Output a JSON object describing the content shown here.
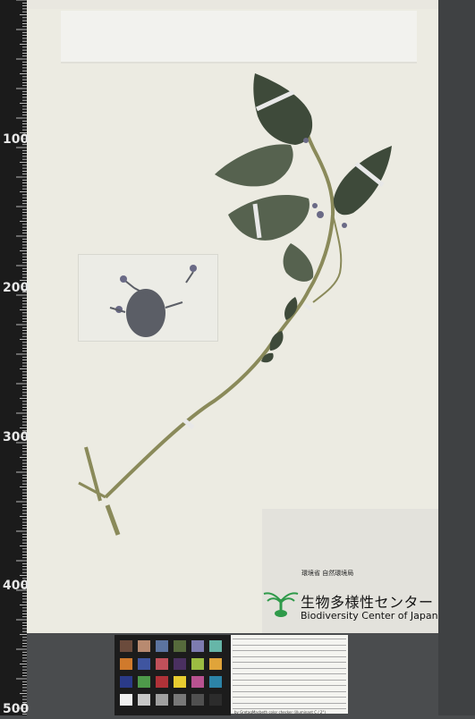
{
  "ruler": {
    "labels": [
      "100",
      "200",
      "300",
      "400",
      "500"
    ]
  },
  "org": {
    "jp_small": "環境省 自然環境局",
    "jp_title": "生物多様性センター",
    "en_title": "Biodiversity Center of Japan"
  },
  "color_table_caption": "by GretagMacbeth color checker (illuminant C / 2°)",
  "colors": {
    "leaf": "#3e4a3a",
    "leaf_light": "#56624f",
    "stem": "#8a8a5a",
    "flower": "#6a6a86",
    "tape": "#e8e8e8",
    "logo_green": "#2f9a4a"
  }
}
